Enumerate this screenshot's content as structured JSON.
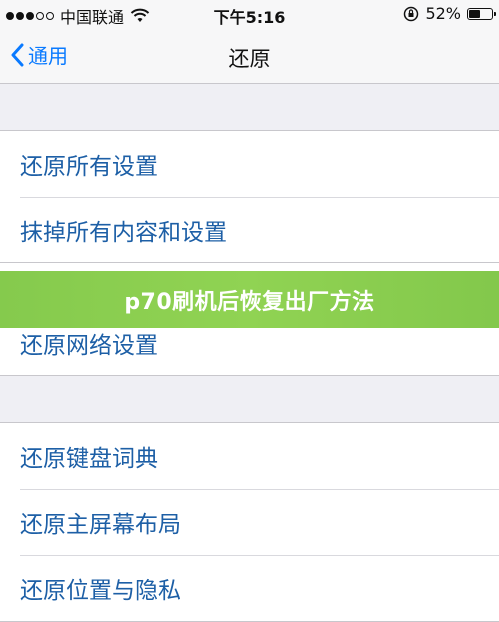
{
  "status_bar": {
    "carrier": "中国联通",
    "time": "下午5:16",
    "battery_percent": "52%",
    "battery_level": 0.52,
    "icons": [
      "signal-dots-icon",
      "wifi-icon",
      "orientation-lock-icon",
      "battery-icon"
    ]
  },
  "nav": {
    "back_label": "通用",
    "title": "还原"
  },
  "group1": {
    "items": [
      {
        "label": "还原所有设置"
      },
      {
        "label": "抹掉所有内容和设置"
      }
    ]
  },
  "group2": {
    "items": [
      {
        "label": "还原网络设置"
      }
    ]
  },
  "group3": {
    "items": [
      {
        "label": "还原键盘词典"
      },
      {
        "label": "还原主屏幕布局"
      },
      {
        "label": "还原位置与隐私"
      }
    ]
  },
  "banner": {
    "text": "p70刷机后恢复出厂方法"
  },
  "colors": {
    "accent": "#0a7aff",
    "row_text": "#1d5fa6",
    "banner_green": "#7fc844",
    "background": "#efeff4"
  }
}
